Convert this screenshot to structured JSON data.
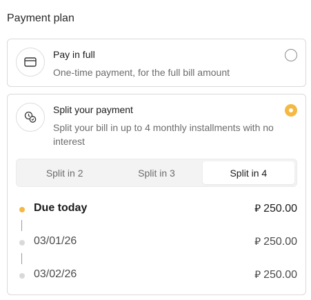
{
  "section_title": "Payment plan",
  "options": [
    {
      "title": "Pay in full",
      "description": "One-time payment, for the full bill amount",
      "icon": "card-icon",
      "selected": false
    },
    {
      "title": "Split your payment",
      "description": "Split your bill in up to 4 monthly installments with no interest",
      "icon": "split-coins-icon",
      "selected": true
    }
  ],
  "tabs": [
    {
      "label": "Split in 2",
      "active": false
    },
    {
      "label": "Split in 3",
      "active": false
    },
    {
      "label": "Split in 4",
      "active": true
    }
  ],
  "schedule": [
    {
      "date": "Due today",
      "amount": "250.00",
      "currency_symbol": "⃁",
      "active": true
    },
    {
      "date": "03/01/26",
      "amount": "250.00",
      "currency_symbol": "⃁",
      "active": false
    },
    {
      "date": "03/02/26",
      "amount": "250.00",
      "currency_symbol": "⃁",
      "active": false
    }
  ],
  "colors": {
    "accent": "#f5b843",
    "border": "#d9d9d9",
    "muted_text": "#6b6b6b"
  }
}
